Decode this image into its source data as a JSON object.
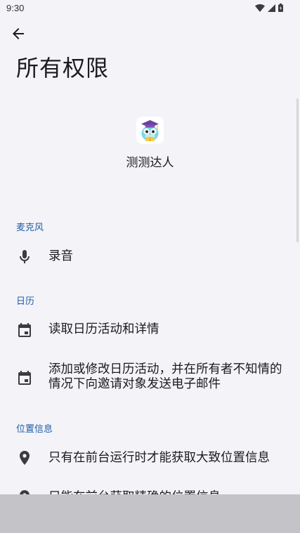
{
  "status_bar": {
    "time": "9:30",
    "icons": [
      "wifi-icon",
      "signal-icon",
      "battery-icon"
    ]
  },
  "header": {
    "back_icon": "arrow-back-icon",
    "title": "所有权限"
  },
  "app": {
    "icon": "owl-graduate-app-icon",
    "name": "测测达人"
  },
  "sections": [
    {
      "title": "麦克风",
      "items": [
        {
          "icon": "microphone-icon",
          "label": "录音"
        }
      ]
    },
    {
      "title": "日历",
      "items": [
        {
          "icon": "calendar-icon",
          "label": "读取日历活动和详情"
        },
        {
          "icon": "calendar-icon",
          "label": "添加或修改日历活动，并在所有者不知情的情况下向邀请对象发送电子邮件"
        }
      ]
    },
    {
      "title": "位置信息",
      "items": [
        {
          "icon": "location-pin-icon",
          "label": "只有在前台运行时才能获取大致位置信息"
        },
        {
          "icon": "location-pin-icon",
          "label": "只能在前台获取精确的位置信息"
        }
      ]
    }
  ],
  "colors": {
    "background": "#f4f3f7",
    "section_header": "#1f5ea8",
    "text": "#1b1b1f"
  }
}
